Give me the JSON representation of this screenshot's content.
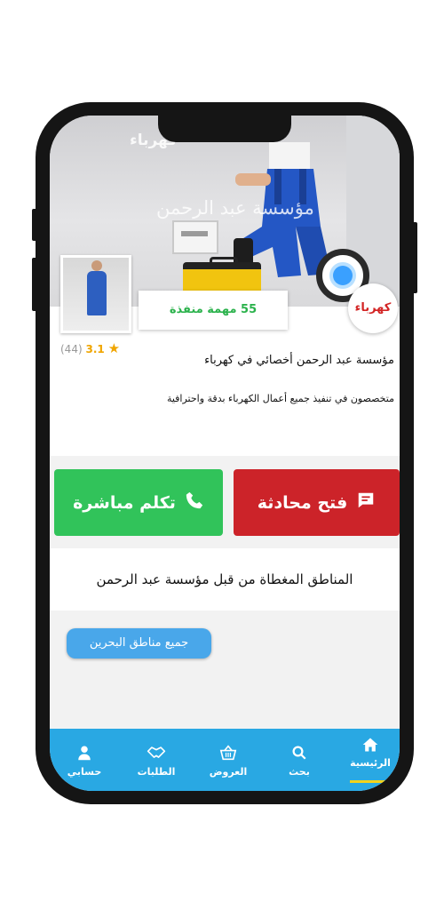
{
  "header": {
    "category_caption": "كهرباء",
    "provider_title": "مؤسسة عبد الرحمن"
  },
  "profile": {
    "tasks_done": "55 مهمة منفذة",
    "category_badge": "كهرباء",
    "rating_value": "3.1",
    "rating_count": "(44)",
    "headline": "مؤسسة عبد الرحمن أخصائي في كهرباء",
    "description": "متخصصون في تنفيذ جميع أعمال الكهرباء بدقة واحترافية"
  },
  "actions": {
    "chat_label": "فتح محادثة",
    "call_label": "تكلم مباشرة"
  },
  "coverage": {
    "title": "المناطق المغطاة من قبل مؤسسة عبد الرحمن",
    "chips": [
      "جميع مناطق البحرين"
    ]
  },
  "nav": {
    "items": [
      {
        "label": "الرئيسية",
        "icon": "home-icon",
        "active": true
      },
      {
        "label": "بحث",
        "icon": "search-icon"
      },
      {
        "label": "العروض",
        "icon": "basket-icon"
      },
      {
        "label": "الطلبات",
        "icon": "handshake-icon"
      },
      {
        "label": "حسابي",
        "icon": "user-icon"
      }
    ]
  },
  "colors": {
    "chat_button": "#cc2329",
    "call_button": "#31c35a",
    "nav_bar": "#29a8e3",
    "chip": "#49a7ea",
    "tasks_text": "#2bb24c",
    "active_indicator": "#f3d21b"
  }
}
